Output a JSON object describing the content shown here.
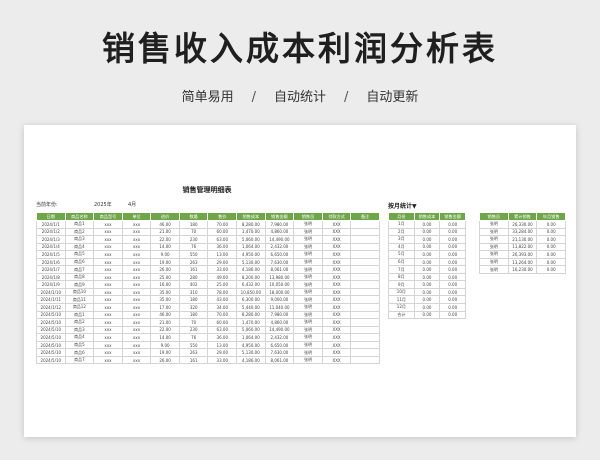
{
  "banner": {
    "title": "销售收入成本利润分析表",
    "tags": [
      "简单易用",
      "自动统计",
      "自动更新"
    ],
    "separator": "/"
  },
  "sheet": {
    "title": "销售管理明细表",
    "current_year_label": "当前年份:",
    "year": "2025年",
    "month": "4月",
    "month_stats_title": "按月统计▼"
  },
  "main_table": {
    "headers": [
      "日期",
      "商品名称",
      "商品型号",
      "单位",
      "进价",
      "数量",
      "售价",
      "销售成本",
      "销售金额",
      "销售员",
      "付款方式",
      "备注"
    ],
    "rows": [
      [
        "2024/1/1",
        "商品1",
        "xxx",
        "xxx",
        "46.00",
        "180",
        "70.00",
        "8,280.00",
        "7,980.00",
        "张明",
        "XXX",
        ""
      ],
      [
        "2024/1/2",
        "商品2",
        "xxx",
        "xxx",
        "21.00",
        "70",
        "60.00",
        "1,470.00",
        "4,860.00",
        "张明",
        "XXX",
        ""
      ],
      [
        "2024/1/3",
        "商品3",
        "xxx",
        "xxx",
        "22.00",
        "230",
        "63.00",
        "5,060.00",
        "14,490.00",
        "张明",
        "XXX",
        ""
      ],
      [
        "2024/1/4",
        "商品4",
        "xxx",
        "xxx",
        "14.00",
        "76",
        "36.00",
        "1,064.00",
        "2,432.00",
        "张明",
        "XXX",
        ""
      ],
      [
        "2024/1/5",
        "商品5",
        "xxx",
        "xxx",
        "9.00",
        "550",
        "13.00",
        "4,950.00",
        "6,650.00",
        "张明",
        "XXX",
        ""
      ],
      [
        "2024/1/6",
        "商品6",
        "xxx",
        "xxx",
        "19.00",
        "263",
        "29.00",
        "5,130.00",
        "7,630.00",
        "张明",
        "XXX",
        ""
      ],
      [
        "2024/1/7",
        "商品7",
        "xxx",
        "xxx",
        "26.00",
        "161",
        "33.00",
        "4,186.00",
        "8,061.00",
        "张明",
        "XXX",
        ""
      ],
      [
        "2024/1/8",
        "商品8",
        "xxx",
        "xxx",
        "25.00",
        "280",
        "49.00",
        "8,200.00",
        "13,980.00",
        "张明",
        "XXX",
        ""
      ],
      [
        "2024/1/9",
        "商品9",
        "xxx",
        "xxx",
        "16.00",
        "402",
        "25.00",
        "6,432.00",
        "10,050.00",
        "张明",
        "XXX",
        ""
      ],
      [
        "2024/1/10",
        "商品10",
        "xxx",
        "xxx",
        "35.00",
        "310",
        "78.00",
        "10,850.00",
        "18,000.00",
        "张明",
        "XXX",
        ""
      ],
      [
        "2024/1/11",
        "商品11",
        "xxx",
        "xxx",
        "35.00",
        "180",
        "43.00",
        "6,300.00",
        "9,000.00",
        "张明",
        "XXX",
        ""
      ],
      [
        "2024/1/12",
        "商品12",
        "xxx",
        "xxx",
        "17.00",
        "320",
        "34.00",
        "5,440.00",
        "11,040.00",
        "张明",
        "XXX",
        ""
      ],
      [
        "2024/5/10",
        "商品1",
        "xxx",
        "xxx",
        "46.00",
        "180",
        "70.00",
        "8,280.00",
        "7,980.00",
        "张明",
        "XXX",
        ""
      ],
      [
        "2024/5/10",
        "商品2",
        "xxx",
        "xxx",
        "21.00",
        "70",
        "60.00",
        "1,470.00",
        "4,860.00",
        "张明",
        "XXX",
        ""
      ],
      [
        "2024/5/10",
        "商品3",
        "xxx",
        "xxx",
        "22.00",
        "230",
        "63.00",
        "5,060.00",
        "14,490.00",
        "张明",
        "XXX",
        ""
      ],
      [
        "2024/5/10",
        "商品4",
        "xxx",
        "xxx",
        "14.00",
        "76",
        "36.00",
        "1,064.00",
        "2,432.00",
        "张明",
        "XXX",
        ""
      ],
      [
        "2024/5/10",
        "商品5",
        "xxx",
        "xxx",
        "9.00",
        "550",
        "13.00",
        "4,950.00",
        "6,650.00",
        "张明",
        "XXX",
        ""
      ],
      [
        "2024/5/10",
        "商品6",
        "xxx",
        "xxx",
        "19.00",
        "263",
        "29.00",
        "5,130.00",
        "7,630.00",
        "张明",
        "XXX",
        ""
      ],
      [
        "2024/5/10",
        "商品7",
        "xxx",
        "xxx",
        "26.00",
        "161",
        "33.00",
        "4,186.00",
        "8,061.00",
        "张明",
        "XXX",
        ""
      ]
    ]
  },
  "month_table": {
    "headers": [
      "月份",
      "销售成本",
      "销售金额"
    ],
    "rows": [
      [
        "1月",
        "0.00",
        "0.00"
      ],
      [
        "2月",
        "0.00",
        "0.00"
      ],
      [
        "3月",
        "0.00",
        "0.00"
      ],
      [
        "4月",
        "0.00",
        "0.00"
      ],
      [
        "5月",
        "0.00",
        "0.00"
      ],
      [
        "6月",
        "0.00",
        "0.00"
      ],
      [
        "7月",
        "0.00",
        "0.00"
      ],
      [
        "8月",
        "0.00",
        "0.00"
      ],
      [
        "9月",
        "0.00",
        "0.00"
      ],
      [
        "10月",
        "0.00",
        "0.00"
      ],
      [
        "11月",
        "0.00",
        "0.00"
      ],
      [
        "12月",
        "0.00",
        "0.00"
      ],
      [
        "合计",
        "0.00",
        "0.00"
      ]
    ]
  },
  "right_table": {
    "headers": [
      "销售员",
      "累计销售",
      "年月销售"
    ],
    "rows": [
      [
        "张明",
        "26,330.00",
        "0.00"
      ],
      [
        "张明",
        "33,284.00",
        "0.00"
      ],
      [
        "张明",
        "21,130.00",
        "0.00"
      ],
      [
        "张明",
        "11,822.00",
        "0.00"
      ],
      [
        "张明",
        "26,393.00",
        "0.00"
      ],
      [
        "张明",
        "13,264.00",
        "0.00"
      ],
      [
        "张明",
        "16,230.00",
        "0.00"
      ]
    ]
  }
}
